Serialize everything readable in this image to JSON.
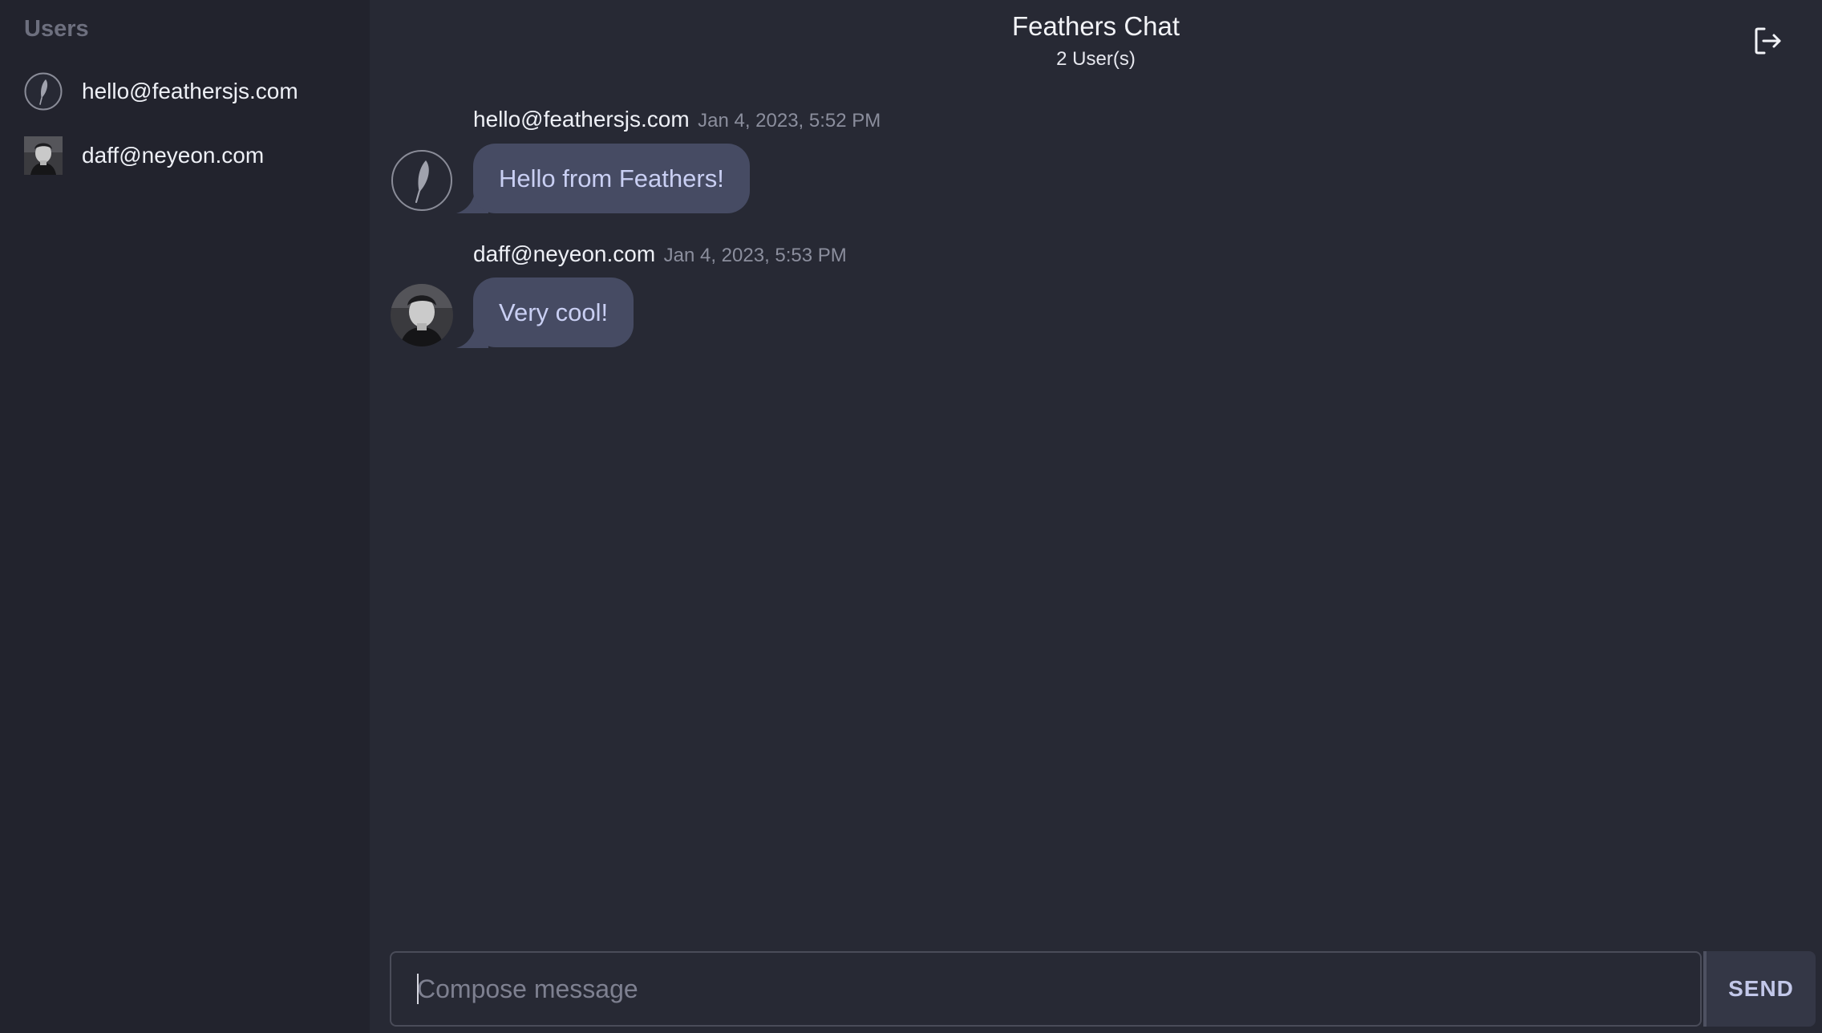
{
  "sidebar": {
    "title": "Users",
    "users": [
      {
        "email": "hello@feathersjs.com",
        "avatar": "feather-icon"
      },
      {
        "email": "daff@neyeon.com",
        "avatar": "user-photo"
      }
    ]
  },
  "header": {
    "title": "Feathers Chat",
    "user_count": "2 User(s)",
    "logout_icon": "logout-icon"
  },
  "messages": [
    {
      "sender": "hello@feathersjs.com",
      "time": "Jan 4, 2023, 5:52 PM",
      "text": "Hello from Feathers!",
      "avatar": "feather-icon"
    },
    {
      "sender": "daff@neyeon.com",
      "time": "Jan 4, 2023, 5:53 PM",
      "text": "Very cool!",
      "avatar": "user-photo"
    }
  ],
  "composer": {
    "placeholder": "Compose message",
    "value": "",
    "send_label": "SEND"
  },
  "colors": {
    "background": "#272934",
    "sidebar": "#22232d",
    "bubble": "#464b63",
    "bubble_text": "#c9cff3",
    "send_text": "#c3c8ea"
  }
}
